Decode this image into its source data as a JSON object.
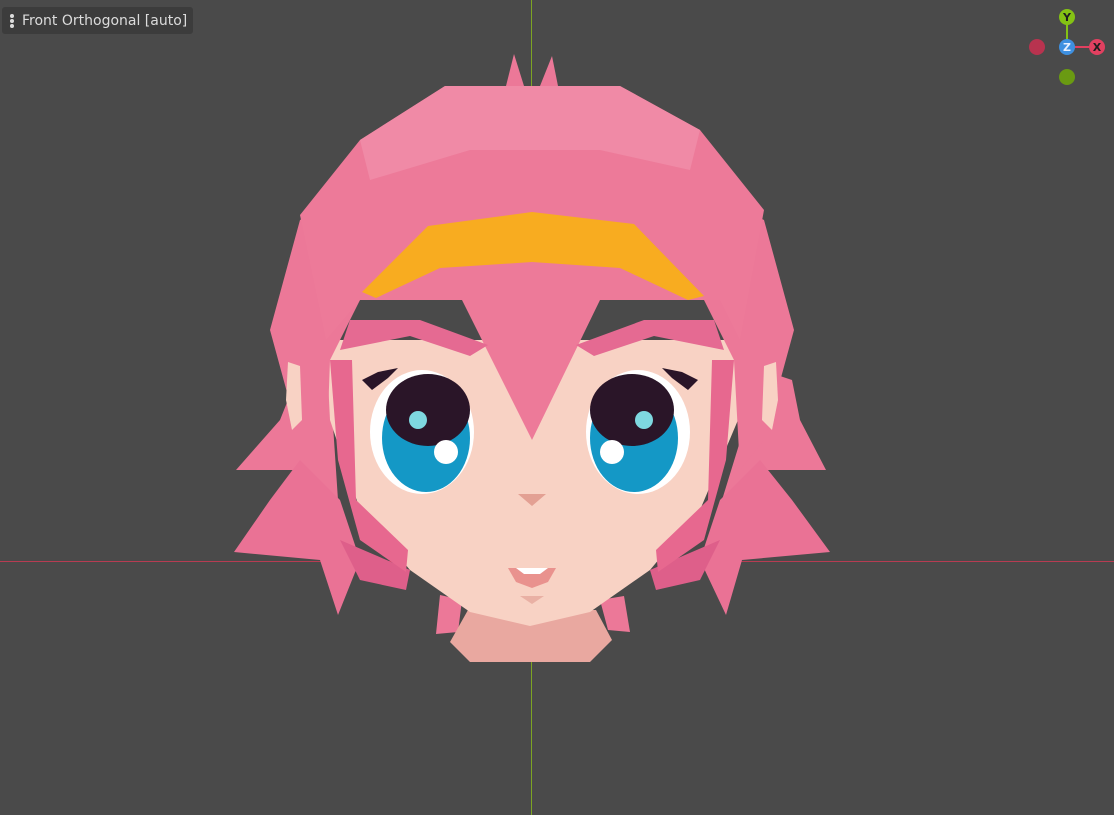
{
  "viewport": {
    "view_label": "Front Orthogonal [auto]",
    "background_color": "#4a4a4a"
  },
  "gizmo": {
    "y_label": "Y",
    "z_label": "Z",
    "x_label": "X",
    "x_color": "#e24060",
    "y_color": "#84c214",
    "z_color": "#3e90e0"
  },
  "axes": {
    "x_axis_color": "#b73c52",
    "y_axis_color": "#7da423"
  },
  "model": {
    "icon": "anime-girl-head-model",
    "hair_color": "#ec7898",
    "headband_color": "#f8ac20",
    "skin_color": "#f8d2c4",
    "eye_color": "#1498c6"
  }
}
